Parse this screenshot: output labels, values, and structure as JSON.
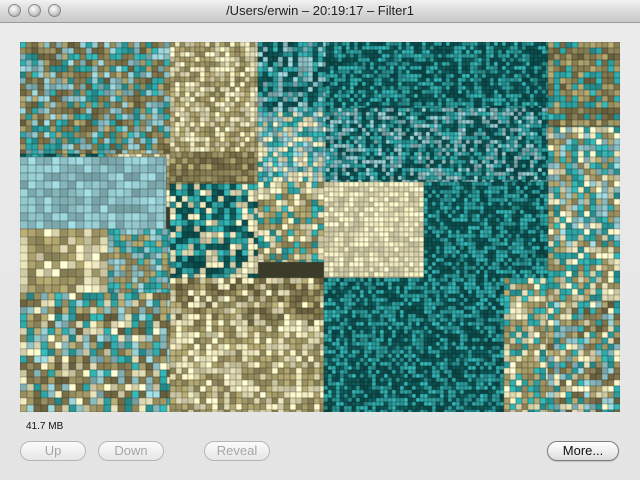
{
  "window": {
    "title": "/Users/erwin – 20:19:17 – Filter1"
  },
  "titlebar_buttons": [
    "close",
    "minimize",
    "zoom"
  ],
  "status": {
    "size": "41.7 MB"
  },
  "toolbar": {
    "up_label": "Up",
    "down_label": "Down",
    "reveal_label": "Reveal",
    "more_label": "More...",
    "up_enabled": false,
    "down_enabled": false,
    "reveal_enabled": false,
    "more_enabled": true
  },
  "treemap": {
    "palette": {
      "khaki": "#a49a68",
      "olive": "#7a7048",
      "cream": "#ece6bc",
      "teal": "#2fa6a6",
      "dark_teal": "#0e5656",
      "light_blue": "#8fc3c8"
    }
  }
}
